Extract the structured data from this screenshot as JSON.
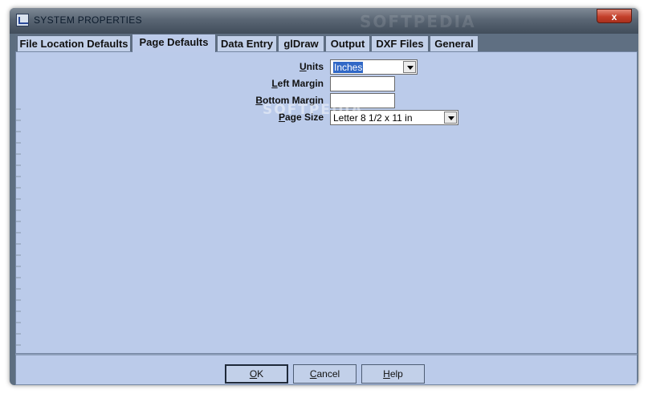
{
  "window": {
    "title": "SYSTEM PROPERTIES",
    "watermark": "SOFTPEDIA",
    "close_label": "x"
  },
  "tabs": [
    {
      "label": "File Location Defaults",
      "active": false
    },
    {
      "label": "Page Defaults",
      "active": true
    },
    {
      "label": "Data Entry",
      "active": false
    },
    {
      "label": "glDraw",
      "active": false
    },
    {
      "label": "Output",
      "active": false
    },
    {
      "label": "DXF Files",
      "active": false
    },
    {
      "label": "General",
      "active": false
    }
  ],
  "form": {
    "units": {
      "label_accel": "U",
      "label_rest": "nits",
      "value": "Inches"
    },
    "left_margin": {
      "label_accel": "L",
      "label_rest": "eft Margin",
      "value": ""
    },
    "bottom_margin": {
      "label_accel": "B",
      "label_rest": "ottom Margin",
      "value": ""
    },
    "page_size": {
      "label_accel": "P",
      "label_rest": "age Size",
      "value": "Letter 8 1/2 x 11 in"
    }
  },
  "content_watermark": "SOFTPEDIA",
  "buttons": {
    "ok": {
      "accel": "O",
      "rest": "K"
    },
    "cancel": {
      "accel": "C",
      "rest": "ancel"
    },
    "help": {
      "accel": "H",
      "rest": "elp"
    }
  }
}
